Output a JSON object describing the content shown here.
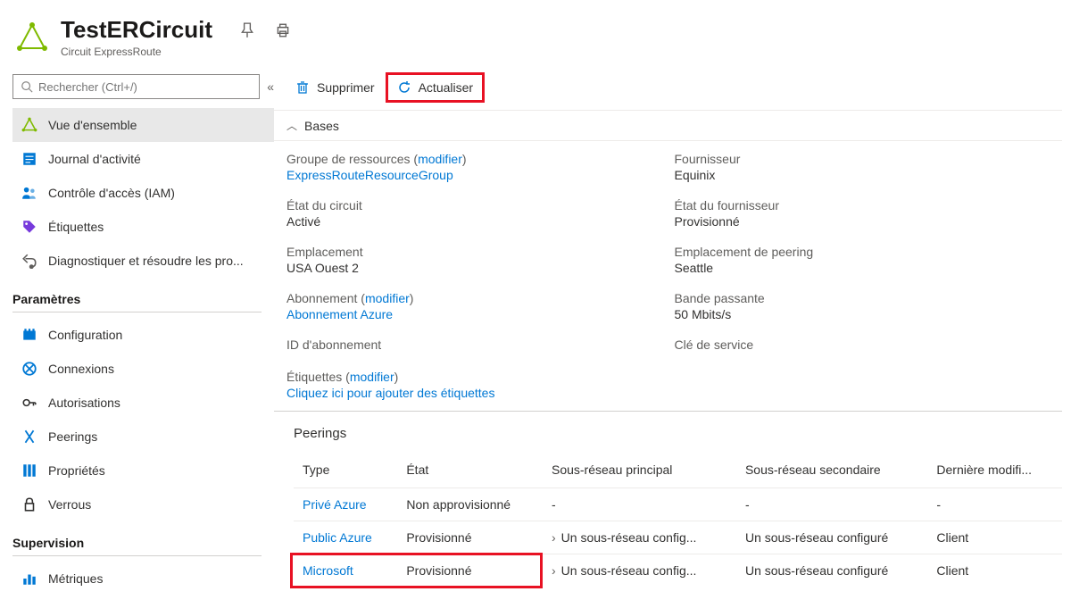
{
  "header": {
    "title": "TestERCircuit",
    "subtitle": "Circuit ExpressRoute"
  },
  "search": {
    "placeholder": "Rechercher (Ctrl+/)"
  },
  "sidebar": {
    "items": [
      {
        "label": "Vue d'ensemble",
        "icon": "overview"
      },
      {
        "label": "Journal d'activité",
        "icon": "activity-log"
      },
      {
        "label": "Contrôle d'accès (IAM)",
        "icon": "iam"
      },
      {
        "label": "Étiquettes",
        "icon": "tags"
      },
      {
        "label": "Diagnostiquer et résoudre les pro...",
        "icon": "diagnose"
      }
    ],
    "section_params": "Paramètres",
    "params_items": [
      {
        "label": "Configuration",
        "icon": "config"
      },
      {
        "label": "Connexions",
        "icon": "connections"
      },
      {
        "label": "Autorisations",
        "icon": "authorizations"
      },
      {
        "label": "Peerings",
        "icon": "peerings"
      },
      {
        "label": "Propriétés",
        "icon": "properties"
      },
      {
        "label": "Verrous",
        "icon": "locks"
      }
    ],
    "section_supervision": "Supervision",
    "supervision_items": [
      {
        "label": "Métriques",
        "icon": "metrics"
      }
    ]
  },
  "toolbar": {
    "delete_label": "Supprimer",
    "refresh_label": "Actualiser"
  },
  "bases": {
    "label": "Bases"
  },
  "properties": {
    "left": [
      {
        "label": "Groupe de ressources",
        "modify": "modifier",
        "value": "ExpressRouteResourceGroup",
        "link": true
      },
      {
        "label": "État du circuit",
        "value": "Activé"
      },
      {
        "label": "Emplacement",
        "value": "USA Ouest 2"
      },
      {
        "label": "Abonnement",
        "modify": "modifier",
        "value": "Abonnement Azure",
        "link": true
      },
      {
        "label": "ID d'abonnement",
        "value": ""
      }
    ],
    "right": [
      {
        "label": "Fournisseur",
        "value": "Equinix"
      },
      {
        "label": "État du fournisseur",
        "value": "Provisionné"
      },
      {
        "label": "Emplacement de peering",
        "value": "Seattle"
      },
      {
        "label": "Bande passante",
        "value": "50 Mbits/s"
      },
      {
        "label": "Clé de service",
        "value": ""
      }
    ]
  },
  "tags": {
    "label": "Étiquettes",
    "modify": "modifier",
    "add_link": "Cliquez ici pour ajouter des étiquettes"
  },
  "peerings": {
    "title": "Peerings",
    "columns": [
      "Type",
      "État",
      "Sous-réseau principal",
      "Sous-réseau secondaire",
      "Dernière modifi..."
    ],
    "rows": [
      {
        "type": "Privé Azure",
        "state": "Non approvisionné",
        "primary": "-",
        "secondary": "-",
        "last": "-"
      },
      {
        "type": "Public Azure",
        "state": "Provisionné",
        "primary": "Un sous-réseau config...",
        "secondary": "Un sous-réseau configuré",
        "last": "Client",
        "chevron": true
      },
      {
        "type": "Microsoft",
        "state": "Provisionné",
        "primary": "Un sous-réseau config...",
        "secondary": "Un sous-réseau configuré",
        "last": "Client",
        "chevron": true
      }
    ]
  }
}
